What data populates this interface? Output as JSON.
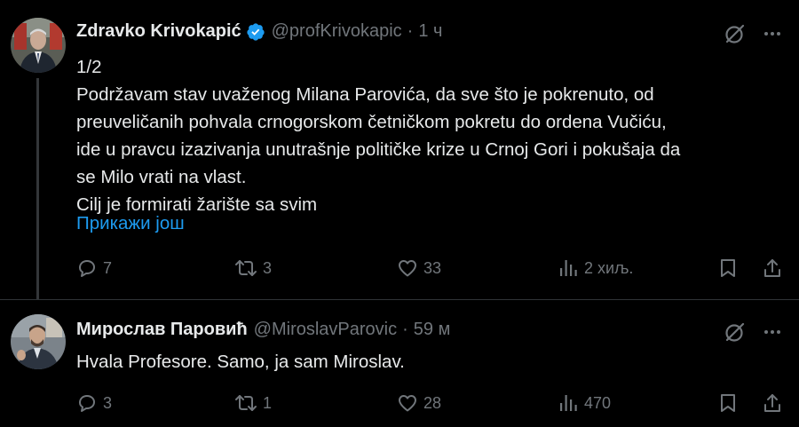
{
  "tweets": [
    {
      "author_name": "Zdravko Krivokapić",
      "handle": "@profKrivokapic",
      "time": "1 ч",
      "verified": true,
      "text_lines": [
        "1/2",
        "Podržavam stav uvaženog Milana Parovića, da sve što je pokrenuto, od",
        "preuveličanih pohvala crnogorskom četničkom pokretu do ordena Vučiću,",
        "ide u pravcu izazivanja unutrašnje političke krize u Crnoj Gori i pokušaja da",
        "se Milo vrati na vlast.",
        "Cilj je formirati žarište sa svim"
      ],
      "show_more": "Прикажи још",
      "replies": "7",
      "reposts": "3",
      "likes": "33",
      "views": "2 хиљ."
    },
    {
      "author_name": "Мирослав Паровић",
      "handle": "@MiroslavParovic",
      "time": "59 м",
      "text": "Hvala Profesore. Samo, ja sam Miroslav.",
      "replies": "3",
      "reposts": "1",
      "likes": "28",
      "views": "470"
    }
  ],
  "icons": {
    "verified": "verified-badge-icon",
    "grok": "grok-icon",
    "more": "more-icon",
    "reply": "reply-icon",
    "repost": "repost-icon",
    "like": "heart-icon",
    "views": "views-icon",
    "bookmark": "bookmark-icon",
    "share": "share-icon"
  },
  "colors": {
    "background": "#000000",
    "text": "#e7e9ea",
    "muted": "#71767b",
    "link": "#1d9bf0",
    "verified": "#1d9bf0",
    "divider": "#2f3336"
  }
}
